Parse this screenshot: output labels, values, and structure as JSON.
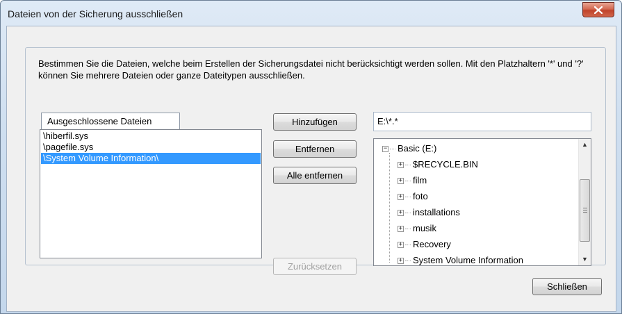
{
  "window": {
    "title": "Dateien von der Sicherung ausschließen",
    "close_glyph": "close-icon"
  },
  "description": "Bestimmen Sie die Dateien, welche beim Erstellen der Sicherungsdatei nicht berücksichtigt werden sollen. Mit den Platzhaltern '*' und '?' können Sie mehrere Dateien oder ganze Dateitypen ausschließen.",
  "excluded": {
    "tab_label": "Ausgeschlossene Dateien",
    "items": [
      {
        "label": "\\hiberfil.sys",
        "selected": false
      },
      {
        "label": "\\pagefile.sys",
        "selected": false
      },
      {
        "label": "\\System Volume Information\\",
        "selected": true
      }
    ]
  },
  "buttons": {
    "add": "Hinzufügen",
    "remove": "Entfernen",
    "remove_all": "Alle entfernen",
    "reset": "Zurücksetzen",
    "close": "Schließen"
  },
  "path_input": {
    "value": "E:\\*.*"
  },
  "tree": {
    "root": "Basic (E:)",
    "children": [
      "$RECYCLE.BIN",
      "film",
      "foto",
      "installations",
      "musik",
      "Recovery",
      "System Volume Information"
    ]
  },
  "colors": {
    "selection": "#3399ff",
    "close_button": "#c0432a"
  }
}
